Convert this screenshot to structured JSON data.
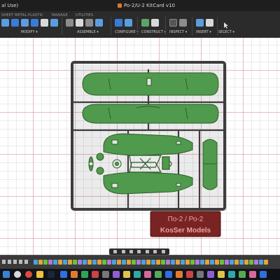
{
  "window": {
    "left_title_fragment": "al Use)",
    "doc_title": "Po-2/U-2 KitCard v10"
  },
  "ribbon": {
    "tabs": [
      "SHEET METAL",
      "PLASTIC",
      "MANAGE",
      "UTILITIES"
    ],
    "groups": [
      "MODIFY ▾",
      "ASSEMBLE ▾",
      "CONFIGURE ▾",
      "CONSTRUCT ▾",
      "INSPECT ▾",
      "INSERT ▾",
      "SELECT ▾"
    ]
  },
  "kit_card": {
    "name_label": "По-2 / Ро-2",
    "maker_label": "KosSer Models"
  },
  "colors": {
    "part_green": "#4f9a4c",
    "sprue_grey": "#3d3d3d",
    "label_bg": "#7a2323",
    "label_text": "#e8a3a3",
    "grid_major": "#dc96a0"
  },
  "icons": [
    "fusion-doc-icon",
    "home-icon",
    "windows-start-icon",
    "chrome-icon",
    "files-icon",
    "steam-icon"
  ]
}
